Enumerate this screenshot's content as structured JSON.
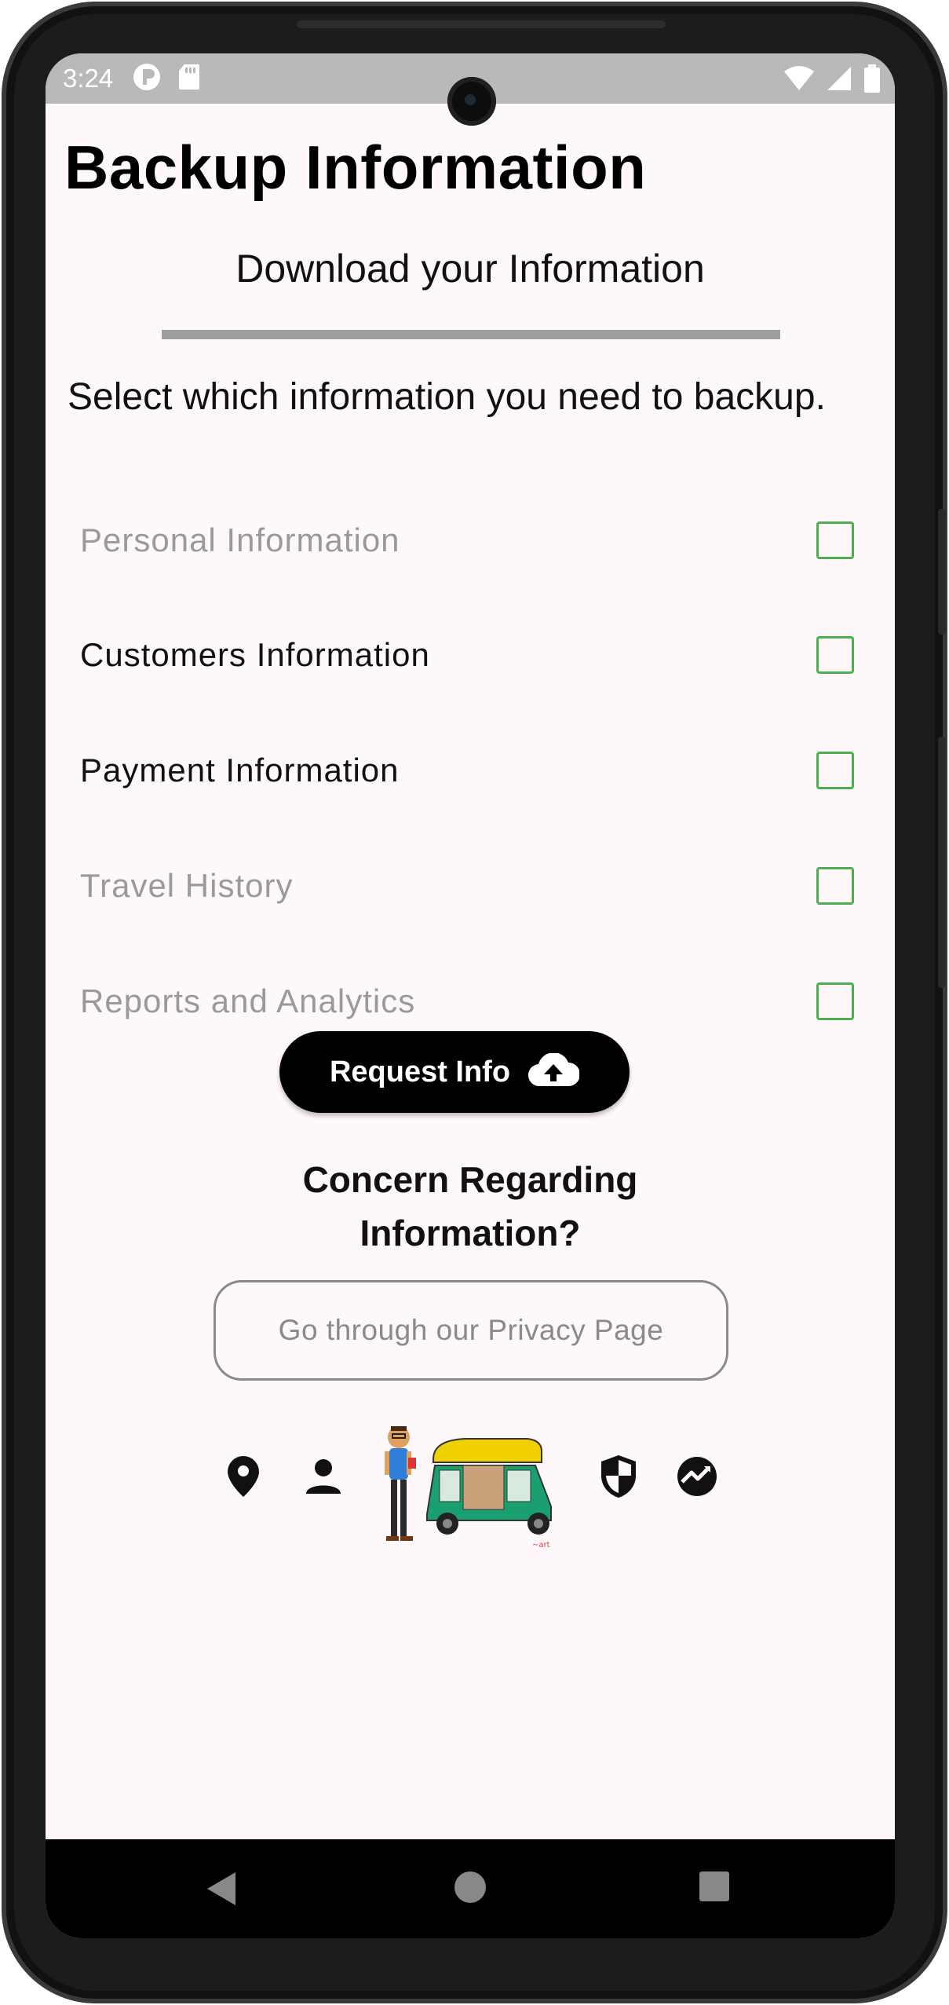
{
  "status_bar": {
    "time": "3:24"
  },
  "header": {
    "title": "Backup Information",
    "subtitle": "Download your Information"
  },
  "instructions": "Select which information you need to backup.",
  "options": [
    {
      "label": "Personal Information",
      "checked": false,
      "state": "disabled"
    },
    {
      "label": "Customers Information",
      "checked": false,
      "state": "enabled"
    },
    {
      "label": "Payment Information",
      "checked": false,
      "state": "enabled"
    },
    {
      "label": "Travel History",
      "checked": false,
      "state": "disabled"
    },
    {
      "label": "Reports and Analytics",
      "checked": false,
      "state": "disabled"
    }
  ],
  "request_button": {
    "label": "Request Info",
    "icon": "cloud-upload-icon"
  },
  "concern": {
    "line1": "Concern Regarding",
    "line2": "Information?"
  },
  "privacy_button": {
    "label": "Go through our Privacy Page"
  },
  "bottom_icons": [
    "location-pin-icon",
    "person-icon",
    "auto-rickshaw-illustration",
    "shield-icon",
    "analytics-icon"
  ],
  "colors": {
    "checkbox_border": "#4caf50",
    "muted_text": "#9a9a9a",
    "screen_bg": "#fff8fb",
    "status_bar_bg": "#b9b9b9"
  }
}
